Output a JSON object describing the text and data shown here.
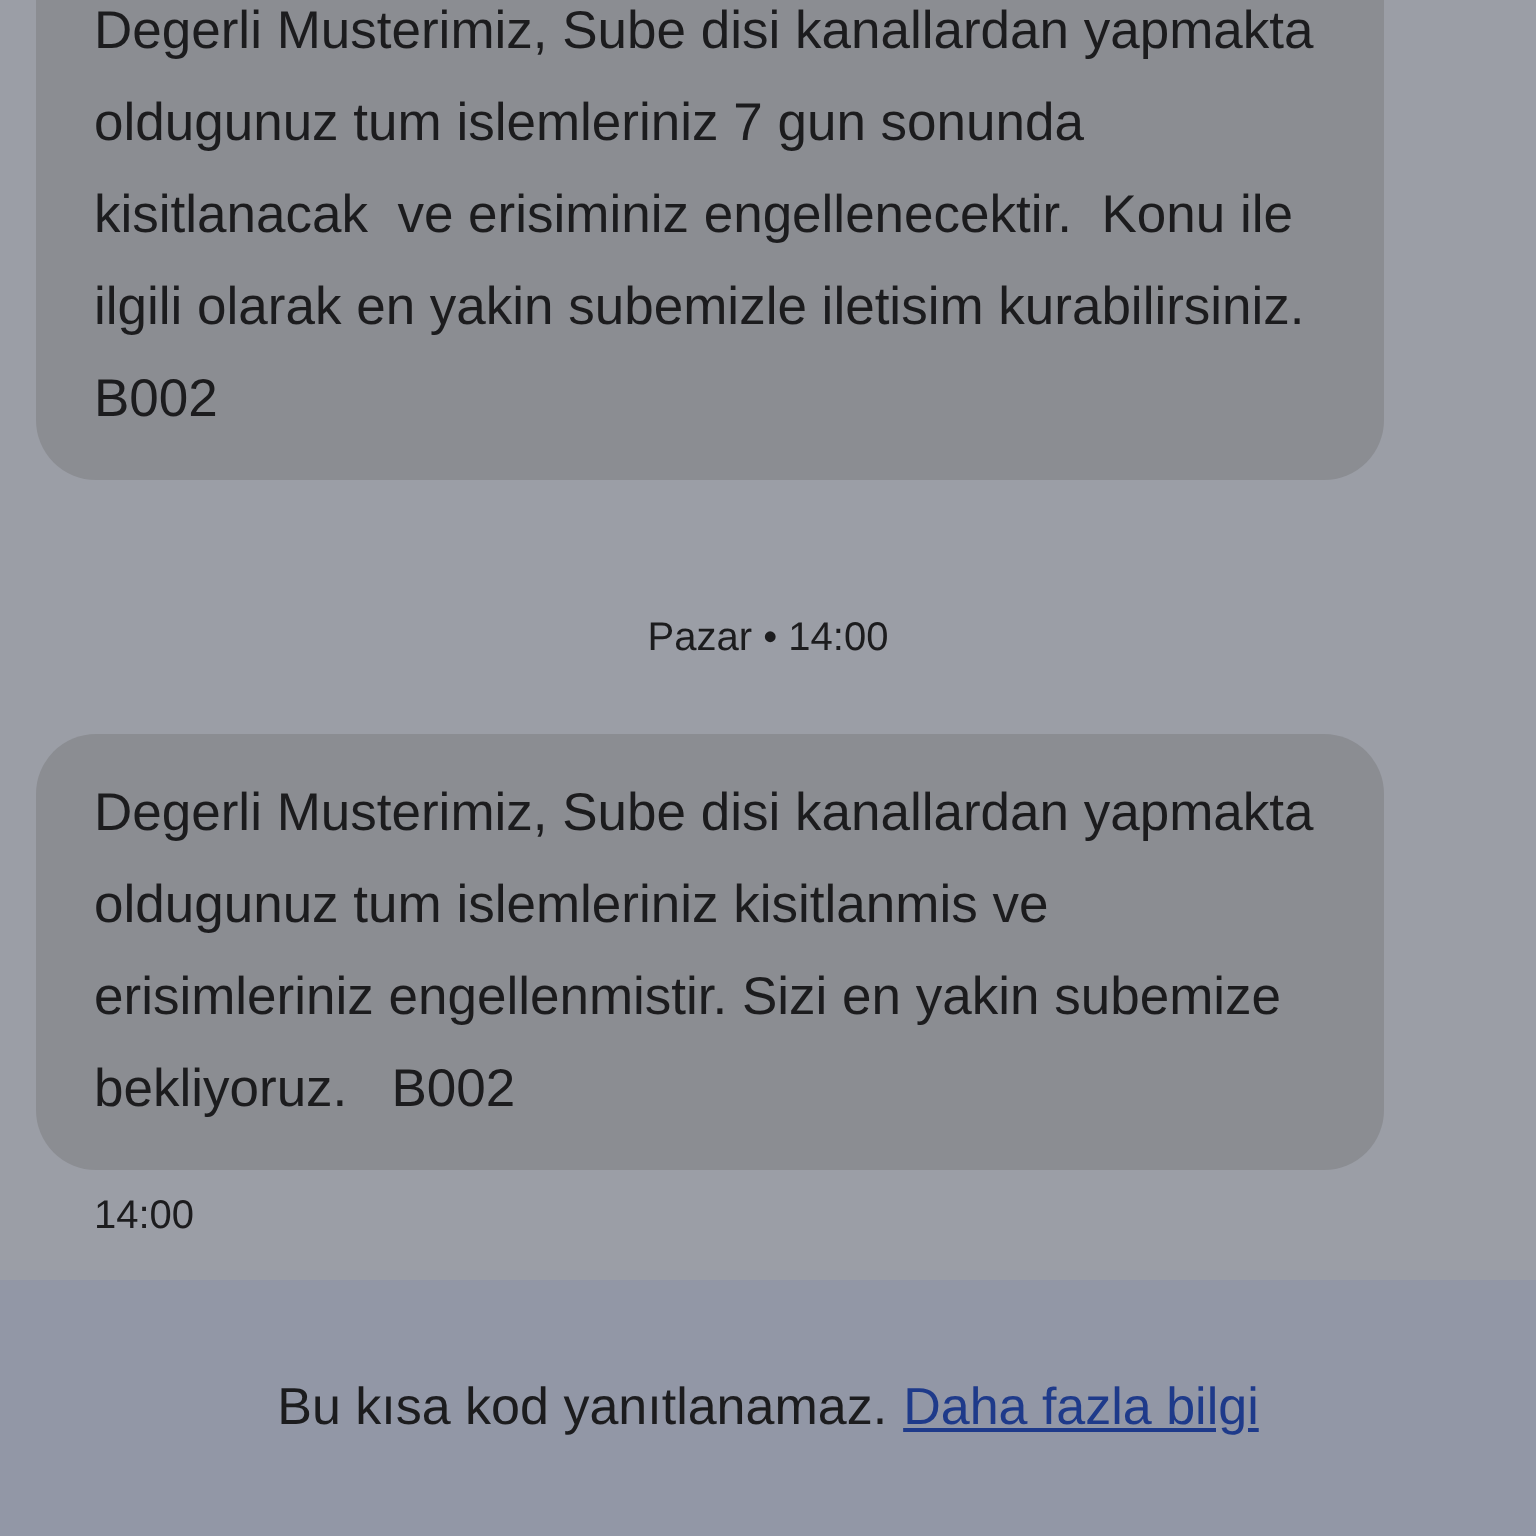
{
  "thread": [
    {
      "kind": "message",
      "text": "Degerli Musterimiz, Sube disi kanallardan yapmakta oldugunuz tum islemleriniz 7 gun sonunda kisitlanacak  ve erisiminiz engellenecektir.  Konu ile ilgili olarak en yakin subemizle iletisim kurabilirsiniz. B002"
    },
    {
      "kind": "date",
      "text": "Pazar • 14:00"
    },
    {
      "kind": "message",
      "text": "Degerli Musterimiz, Sube disi kanallardan yapmakta oldugunuz tum islemleriniz kisitlanmis ve erisimleriniz engellenmistir. Sizi en yakin subemize bekliyoruz.   B002"
    },
    {
      "kind": "time",
      "text": "14:00"
    }
  ],
  "footer": {
    "notice": "Bu kısa kod yanıtlanamaz.",
    "link": "Daha fazla bilgi"
  }
}
